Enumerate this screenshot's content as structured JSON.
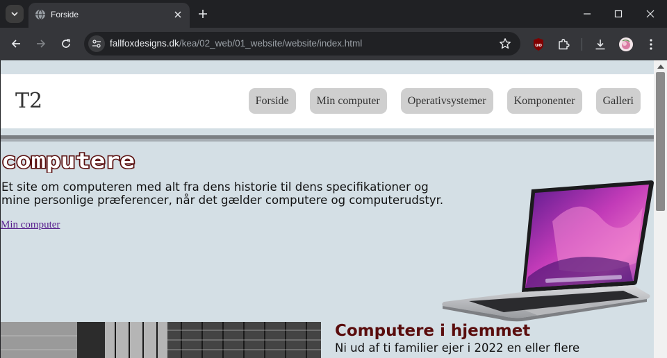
{
  "browser": {
    "tab_title": "Forside",
    "url_host": "fallfoxdesigns.dk",
    "url_path": "/kea/02_web/01_website/website/index.html"
  },
  "site": {
    "logo": "T2",
    "nav": [
      "Forside",
      "Min computer",
      "Operativsystemer",
      "Komponenter",
      "Galleri"
    ],
    "hero": {
      "title": "computere",
      "text": "Et site om computeren med alt fra dens historie til dens specifikationer og mine personlige præferencer, når det gælder computere og computerudstyr.",
      "link": "Min computer"
    },
    "section": {
      "title": "Computere i hjemmet",
      "text": "Ni ud af ti familier ejer i 2022 en eller flere"
    }
  },
  "colors": {
    "page_bg": "#d4dfe5",
    "header_bg": "#ffffff",
    "menu_button": "#cfcfcf",
    "section_title": "#5a0d0d",
    "link_visited": "#551a8b"
  },
  "icons": [
    "tab-search-icon",
    "globe-icon",
    "close-icon",
    "plus-icon",
    "minimize-icon",
    "maximize-icon",
    "window-close-icon",
    "back-icon",
    "forward-icon",
    "reload-icon",
    "site-info-icon",
    "star-icon",
    "ublock-icon",
    "extensions-icon",
    "download-icon",
    "profile-avatar",
    "more-icon"
  ]
}
